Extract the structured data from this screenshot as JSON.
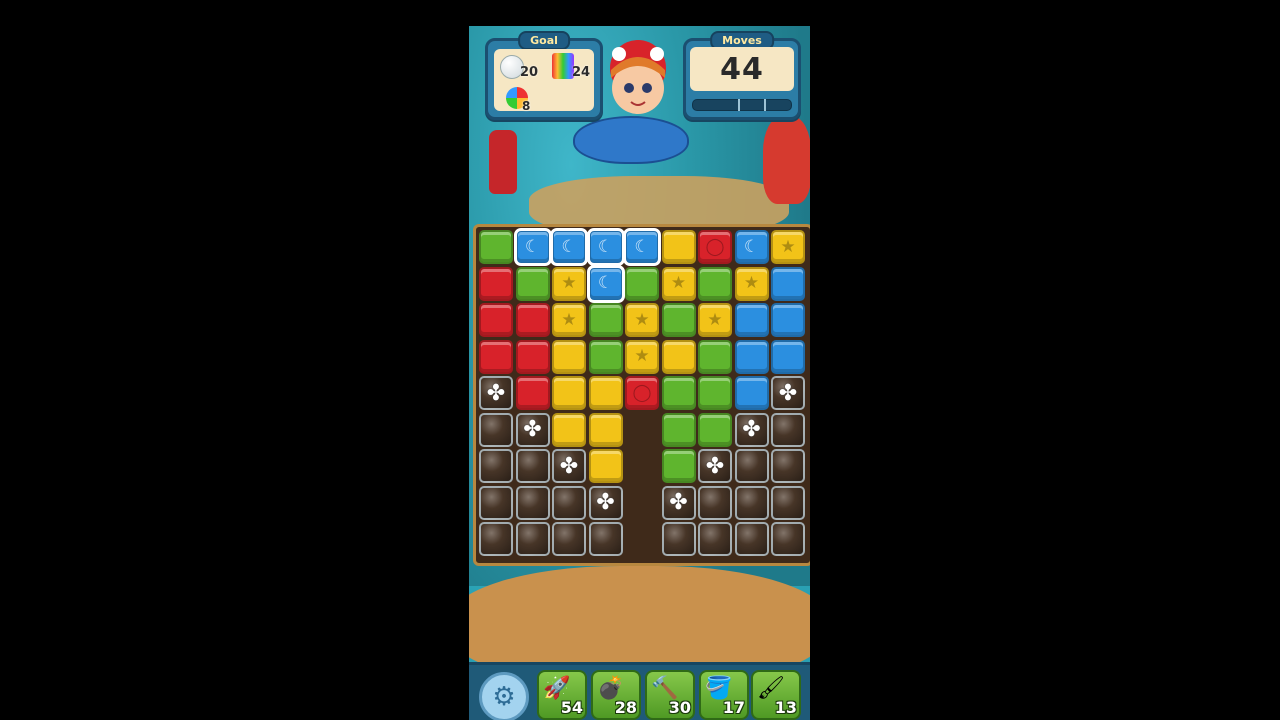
{
  "hud": {
    "goal_label": "Goal",
    "moves_label": "Moves",
    "moves_value": "44",
    "goals": [
      {
        "name": "bubble",
        "count": "20"
      },
      {
        "name": "rainbow-block",
        "count": "24"
      },
      {
        "name": "pinwheel",
        "count": "8"
      }
    ],
    "progress": 0.0
  },
  "board": {
    "colors": {
      "G": "#5fb52e",
      "B": "#2b8fe0",
      "Y": "#f2c318",
      "R": "#d8222a"
    },
    "rows": [
      [
        "G",
        "B",
        "B",
        "B",
        "B",
        "Y",
        "R",
        "B",
        "Y"
      ],
      [
        "R",
        "G",
        "Y",
        "B",
        "G",
        "Y",
        "G",
        "Y",
        "B"
      ],
      [
        "R",
        "R",
        "Y",
        "G",
        "Y",
        "G",
        "Y",
        "B",
        "B"
      ],
      [
        "R",
        "R",
        "Y",
        "G",
        "Y",
        "Y",
        "G",
        "B",
        "B"
      ],
      [
        "P",
        "R",
        "Y",
        "Y",
        "R",
        "G",
        "G",
        "B",
        "P"
      ],
      [
        "X",
        "P",
        "Y",
        "Y",
        "_",
        "G",
        "G",
        "P",
        "X"
      ],
      [
        "X",
        "X",
        "P",
        "Y",
        "_",
        "G",
        "P",
        "X",
        "X"
      ],
      [
        "X",
        "X",
        "X",
        "P",
        "_",
        "P",
        "X",
        "X",
        "X"
      ],
      [
        "X",
        "X",
        "X",
        "X",
        "_",
        "X",
        "X",
        "X",
        "X"
      ]
    ],
    "selected": [
      [
        0,
        1
      ],
      [
        0,
        2
      ],
      [
        0,
        3
      ],
      [
        0,
        4
      ],
      [
        1,
        3
      ]
    ],
    "glyphs": {
      "0,1": "moon",
      "0,2": "moon",
      "0,3": "moon",
      "0,4": "moon",
      "1,3": "moon",
      "0,7": "moon",
      "0,6": "circle",
      "4,4": "circle",
      "0,8": "star",
      "1,2": "star",
      "1,5": "star",
      "1,7": "star",
      "2,2": "star",
      "2,6": "star",
      "3,4": "star",
      "2,4": "star"
    }
  },
  "boosters": [
    {
      "name": "rocket",
      "count": "54"
    },
    {
      "name": "cannon",
      "count": "28"
    },
    {
      "name": "hammer",
      "count": "30"
    },
    {
      "name": "bucket",
      "count": "17"
    },
    {
      "name": "rainbow-brush",
      "count": "13"
    }
  ]
}
